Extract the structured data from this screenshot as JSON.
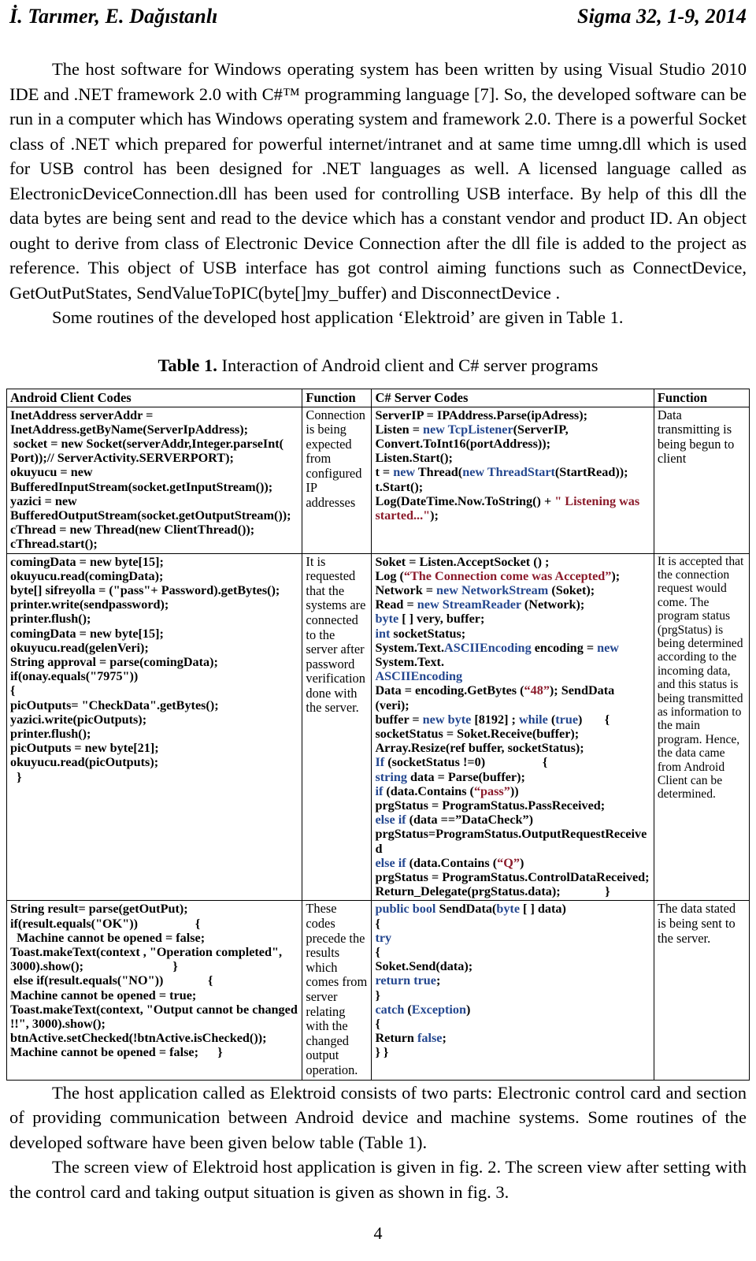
{
  "header": {
    "authors": "İ. Tarımer, E. Dağıstanlı",
    "journal_ref": "Sigma 32, 1-9, 2014"
  },
  "paragraphs": {
    "p1": "The host software for Windows operating system has been written by using Visual Studio 2010 IDE and .NET framework 2.0 with C#™  programming language [7]. So, the developed software can be run in a computer which has Windows operating system and framework 2.0. There is a powerful Socket class of .NET which prepared for powerful internet/intranet and at same time umng.dll which is used for USB control has been designed for .NET languages as well. A licensed language called as ElectronicDeviceConnection.dll has been used for controlling USB interface. By help of this dll the data bytes are being sent and read to the device which has a constant vendor and product ID. An object ought to derive from class of Electronic Device Connection after the dll file is added to the project as reference. This object of USB interface has got control aiming functions such as ConnectDevice, GetOutPutStates, SendValueToPIC(byte[]my_buffer) and DisconnectDevice .",
    "p2": "Some routines of the developed host application ‘Elektroid’ are given in Table 1.",
    "p3": "The host application called as Elektroid consists of two parts: Electronic control card and section of providing communication between Android device and machine systems. Some routines of the developed software have been given below table (Table 1).",
    "p4": "The screen view of Elektroid host application is given in fig. 2. The screen view after setting with the control card and taking output situation is given as shown in fig. 3."
  },
  "table_caption": {
    "label": "Table 1.",
    "text": " Interaction of Android client and C# server programs"
  },
  "table": {
    "headers": {
      "android": "Android Client Codes",
      "function1": "Function",
      "csharp": "C# Server Codes",
      "function2": "Function"
    },
    "rows": [
      {
        "android_code": "InetAddress serverAddr =\nInetAddress.getByName(ServerIpAddress);\n socket = new Socket(serverAddr,Integer.parseInt(\nPort));// ServerActivity.SERVERPORT);\nokuyucu = new\nBufferedInputStream(socket.getInputStream());\nyazici = new\nBufferedOutputStream(socket.getOutputStream());\ncThread = new Thread(new ClientThread());\ncThread.start();",
        "function1": "Connection is being expected from configured IP addresses",
        "csharp_plain": "ServerIP = IPAddress.Parse(ipAdress);\nListen = new TcpListener(ServerIP,\nConvert.ToInt16(portAddress));\nListen.Start();\nt = new Thread(new ThreadStart(StartRead));\nt.Start();\nLog(DateTime.Now.ToString() + \" Listening was started...\");",
        "function2": "Data transmitting is being begun to client"
      },
      {
        "android_code": "comingData = new byte[15];\nokuyucu.read(comingData);\nbyte[] sifreyolla = (\"pass\"+ Password).getBytes();\nprinter.write(sendpassword);\nprinter.flush();\ncomingData = new byte[15];\nokuyucu.read(gelenVeri);\nString approval = parse(comingData);\nif(onay.equals(\"7975\"))\n{\npicOutputs= \"CheckData\".getBytes();\nyazici.write(picOutputs);\nprinter.flush();\npicOutputs = new byte[21];\nokuyucu.read(picOutputs);\n  }",
        "function1": "It is requested that the systems are connected to the server after password verification done with the server.",
        "csharp_plain": "Soket = Listen.AcceptSocket () ;\nLog (“The Connection come was Accepted”);\nNetwork = new NetworkStream (Soket);\nRead = new StreamReader (Network);\nbyte [ ] very, buffer;\nint socketStatus;\nSystem.Text.ASCIIEncoding encoding = new System.Text.\nASCIIEncoding\nData = encoding.GetBytes (“48”); SendData (veri);\nbuffer = new byte [8192] ; while (true)       {\nsocketStatus = Soket.Receive(buffer);\nArray.Resize(ref buffer, socketStatus);\nIf (socketStatus !=0)                  {\nstring data = Parse(buffer);\nif (data.Contains (“pass”))\nprgStatus = ProgramStatus.PassReceived;\nelse if (data ==”DataCheck”)\nprgStatus=ProgramStatus.OutputRequestReceived\nelse if (data.Contains (“Q”)\nprgStatus = ProgramStatus.ControlDataReceived;\nReturn_Delegate(prgStatus.data);              }",
        "function2": "It is accepted that the connection request would come. The program status (prgStatus) is being determined according to the incoming data, and this status is being transmitted as information to the main program. Hence, the data came from Android Client can be determined."
      },
      {
        "android_code": "String result= parse(getOutPut);\nif(result.equals(\"OK\"))                  {\n  Machine cannot be opened = false;\nToast.makeText(context , \"Operation completed\", 3000).show();                            }\n else if(result.equals(\"NO\"))              {\nMachine cannot be opened = true;\nToast.makeText(context, \"Output cannot be changed !!\", 3000).show();\nbtnActive.setChecked(!btnActive.isChecked());\nMachine cannot be opened = false;      }",
        "function1": "These codes precede the results which comes from server relating with the changed output operation.",
        "csharp_plain": "public bool SendData(byte [ ] data)\n{\ntry\n{\nSoket.Send(data);\nreturn true;\n}\ncatch (Exception)\n{\nReturn false;\n} }",
        "function2": "The data stated is being sent to the server."
      }
    ]
  },
  "page_number": "4",
  "colors": {
    "keyword_blue": "#24478f",
    "string_red": "#8b1b2b",
    "text_black": "#000000",
    "rule_black": "#000000"
  }
}
